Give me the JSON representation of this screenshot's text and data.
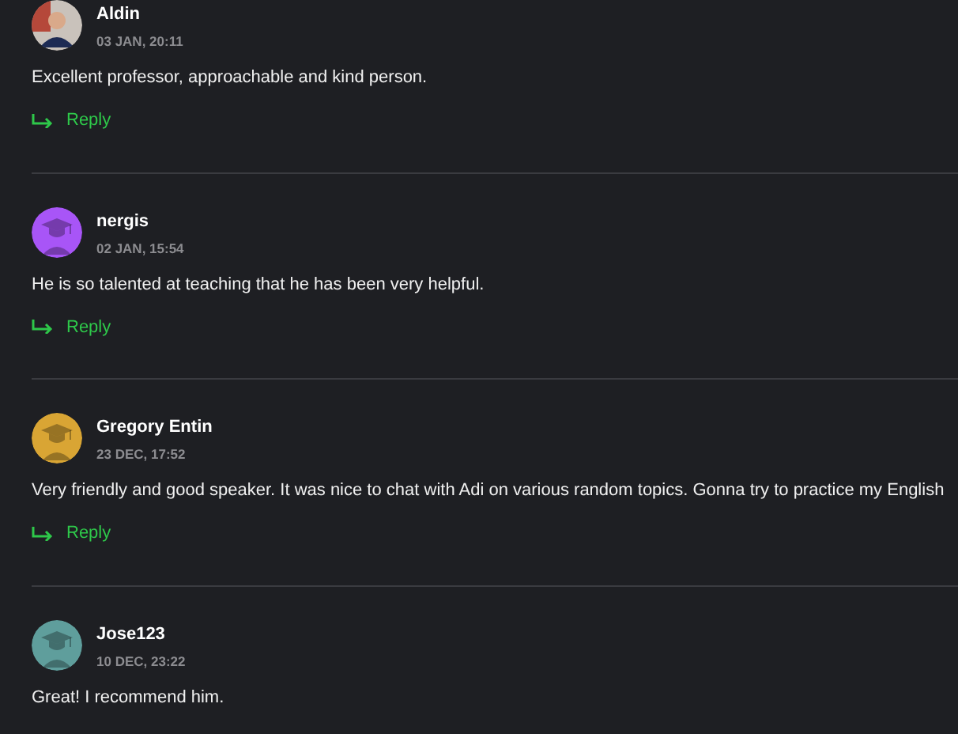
{
  "comments": [
    {
      "author": "Aldin",
      "date": "03 JAN, 20:11",
      "text": "Excellent professor, approachable and kind person.",
      "avatar": {
        "kind": "photo"
      },
      "reply": "Reply"
    },
    {
      "author": "nergis",
      "date": "02 JAN, 15:54",
      "text": "He is so talented at teaching that he has been very helpful.",
      "avatar": {
        "kind": "default",
        "color": "#a855f7"
      },
      "reply": "Reply"
    },
    {
      "author": "Gregory Entin",
      "date": "23 DEC, 17:52",
      "text": "Very friendly and good speaker. It was nice to chat with Adi on various random topics. Gonna try to practice my English",
      "avatar": {
        "kind": "default",
        "color": "#d9a534"
      },
      "reply": "Reply"
    },
    {
      "author": "Jose123",
      "date": "10 DEC, 23:22",
      "text": "Great! I recommend him.",
      "avatar": {
        "kind": "default",
        "color": "#5f9e9c"
      }
    }
  ]
}
